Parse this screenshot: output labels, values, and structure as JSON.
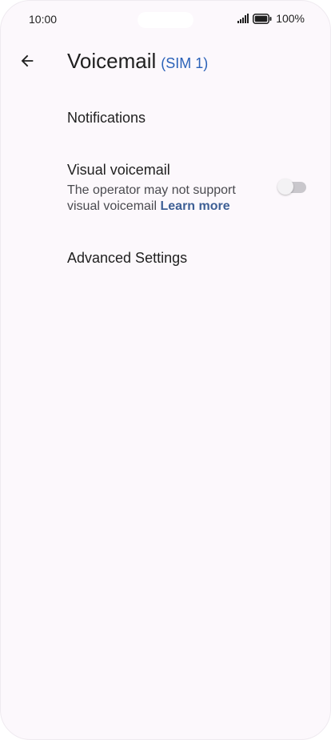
{
  "status_bar": {
    "time": "10:00",
    "battery_percent": "100%",
    "icons": [
      "signal-icon",
      "battery-icon"
    ]
  },
  "app_bar": {
    "title": "Voicemail",
    "sim_label": "(SIM 1)",
    "back_icon": "arrow-back-icon"
  },
  "settings": {
    "notifications": {
      "title": "Notifications"
    },
    "visual_voicemail": {
      "title": "Visual voicemail",
      "summary": "The operator may not support visual voicemail",
      "learn_more": "Learn more",
      "enabled": false
    },
    "advanced": {
      "title": "Advanced Settings"
    }
  },
  "colors": {
    "background": "#fcf8fc",
    "accent": "#2b62b8",
    "link": "#3e5f95",
    "toggle_off_track": "#c9c7cc"
  }
}
